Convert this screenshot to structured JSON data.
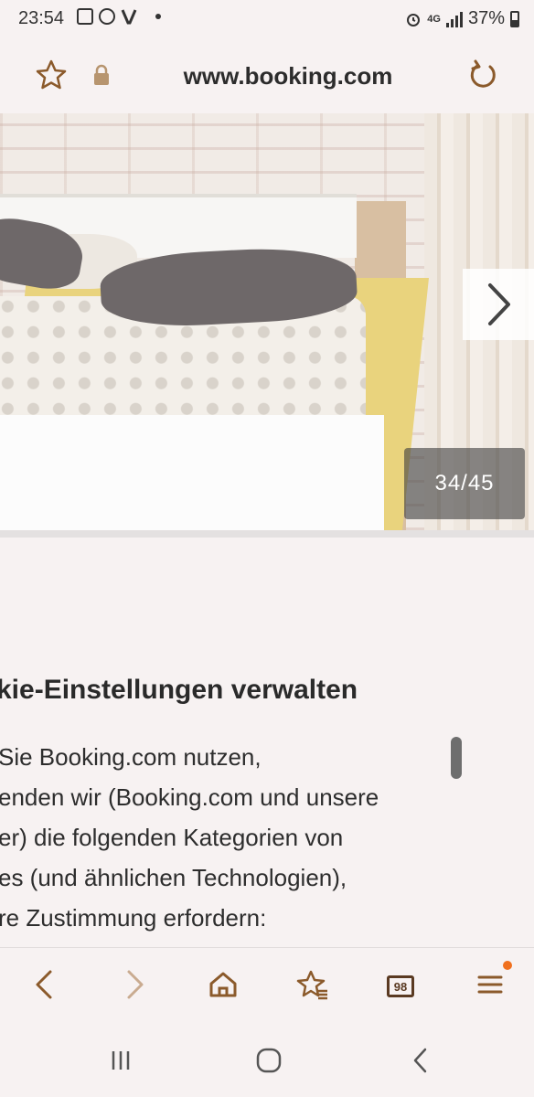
{
  "status_bar": {
    "time": "23:54",
    "network": "4G",
    "battery": "37%",
    "left_icons": [
      "gallery-icon",
      "viber-icon",
      "v-app-icon",
      "dot-icon"
    ],
    "right_icons": [
      "alarm-icon",
      "network-icon",
      "signal-icon",
      "battery-icon"
    ]
  },
  "url_bar": {
    "url": "www.booking.com",
    "icons": [
      "star-icon",
      "lock-icon",
      "reload-icon"
    ]
  },
  "gallery": {
    "counter": "34/45",
    "next_icon": "chevron-right-icon"
  },
  "cookie_panel": {
    "heading": "kie-Einstellungen verwalten",
    "lines": [
      " Sie Booking.com nutzen,",
      "enden wir (Booking.com und unsere",
      "er) die folgenden Kategorien von",
      "es (und ähnlichen Technologien),",
      "re Zustimmung erfordern:"
    ]
  },
  "toolbar": {
    "back": "back-icon",
    "forward": "forward-icon",
    "home": "home-icon",
    "bookmarks": "bookmarks-icon",
    "tabs_count": "98",
    "menu": "menu-icon"
  },
  "navigation": {
    "recents": "recents-icon",
    "home": "home-circle-icon",
    "back": "back-chevron-icon"
  },
  "colors": {
    "accent": "#8b5a2b",
    "notification": "#f0701e",
    "background": "#f7f2f2"
  }
}
